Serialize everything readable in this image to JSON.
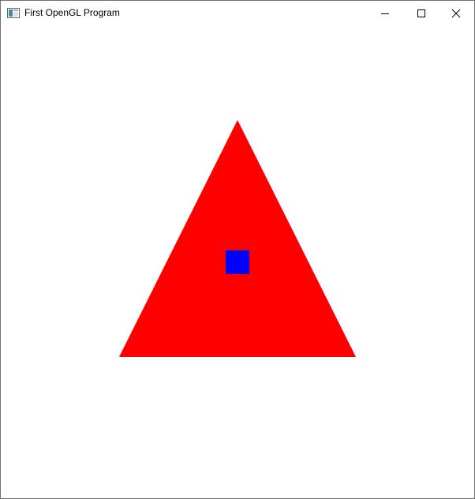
{
  "window": {
    "title": "First OpenGL Program",
    "icon": "app-window-icon",
    "controls": {
      "minimize": "minimize-icon",
      "maximize": "maximize-icon",
      "close": "close-icon"
    }
  },
  "scene": {
    "background_color": "#ffffff",
    "shapes": [
      {
        "type": "triangle",
        "color": "#ff0000"
      },
      {
        "type": "square",
        "color": "#0000ff"
      }
    ]
  }
}
